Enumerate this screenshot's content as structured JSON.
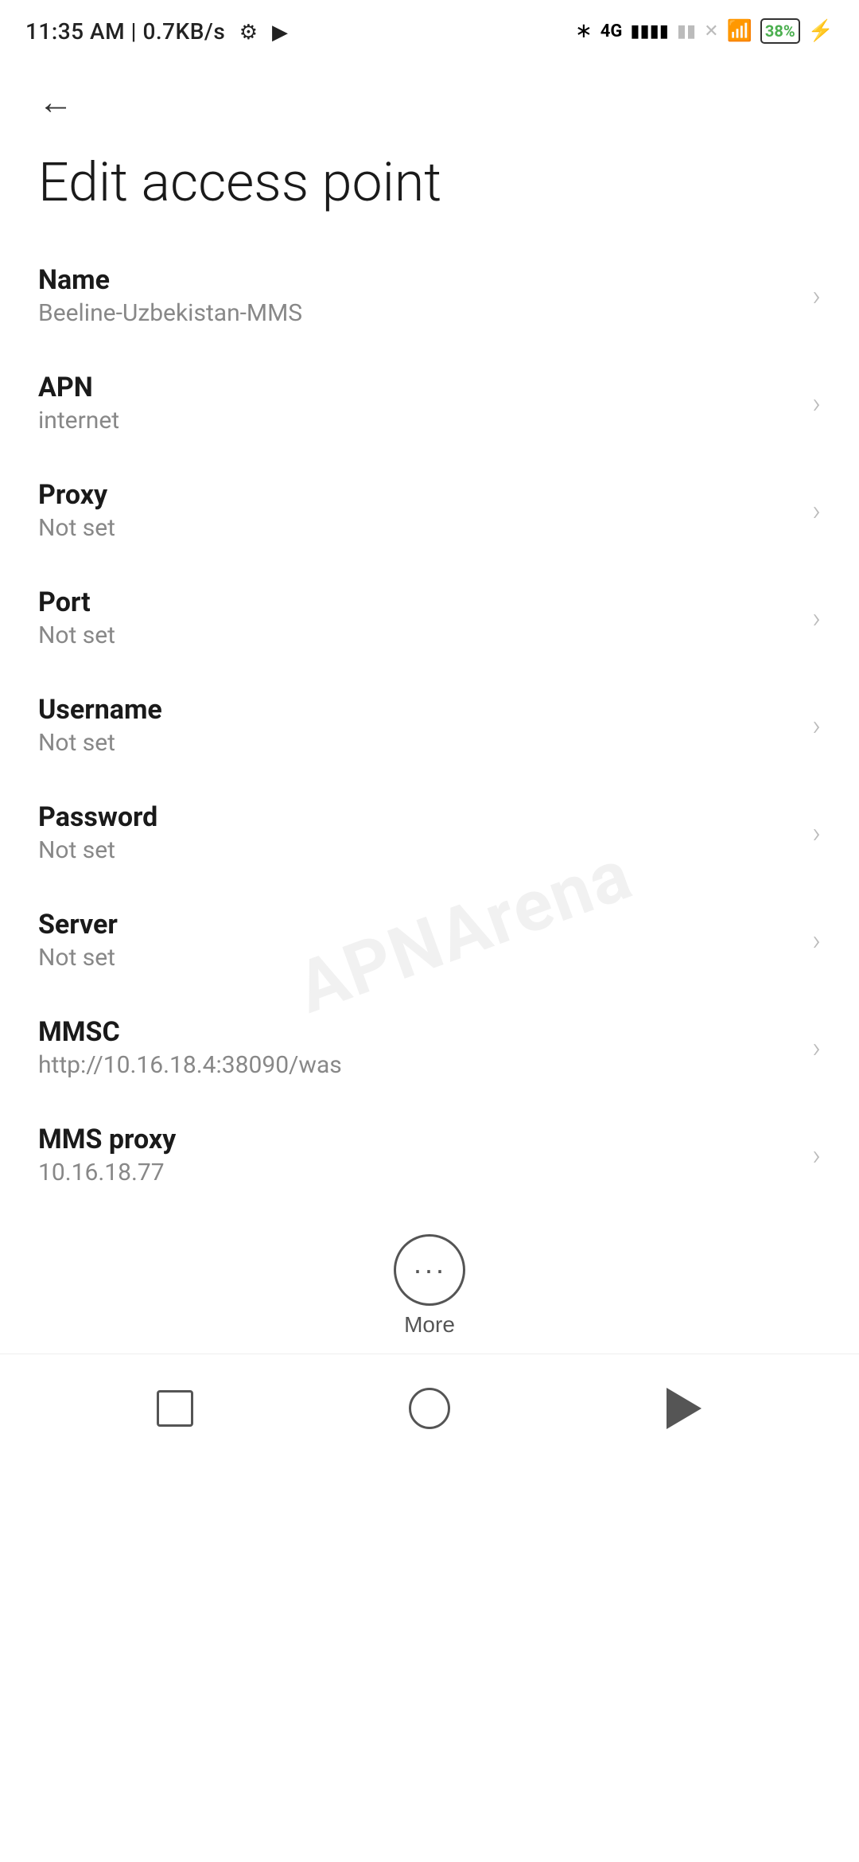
{
  "statusBar": {
    "time": "11:35 AM",
    "speed": "0.7KB/s",
    "batteryPercent": "38"
  },
  "navigation": {
    "backLabel": "←"
  },
  "page": {
    "title": "Edit access point"
  },
  "settings": [
    {
      "label": "Name",
      "value": "Beeline-Uzbekistan-MMS"
    },
    {
      "label": "APN",
      "value": "internet"
    },
    {
      "label": "Proxy",
      "value": "Not set"
    },
    {
      "label": "Port",
      "value": "Not set"
    },
    {
      "label": "Username",
      "value": "Not set"
    },
    {
      "label": "Password",
      "value": "Not set"
    },
    {
      "label": "Server",
      "value": "Not set"
    },
    {
      "label": "MMSC",
      "value": "http://10.16.18.4:38090/was"
    },
    {
      "label": "MMS proxy",
      "value": "10.16.18.77"
    }
  ],
  "bottomBar": {
    "moreLabel": "More",
    "moreDotsIcon": "···"
  },
  "watermark": {
    "text": "APNArena"
  },
  "navBar": {
    "squareLabel": "recent-apps",
    "circleLabel": "home",
    "triangleLabel": "back"
  }
}
